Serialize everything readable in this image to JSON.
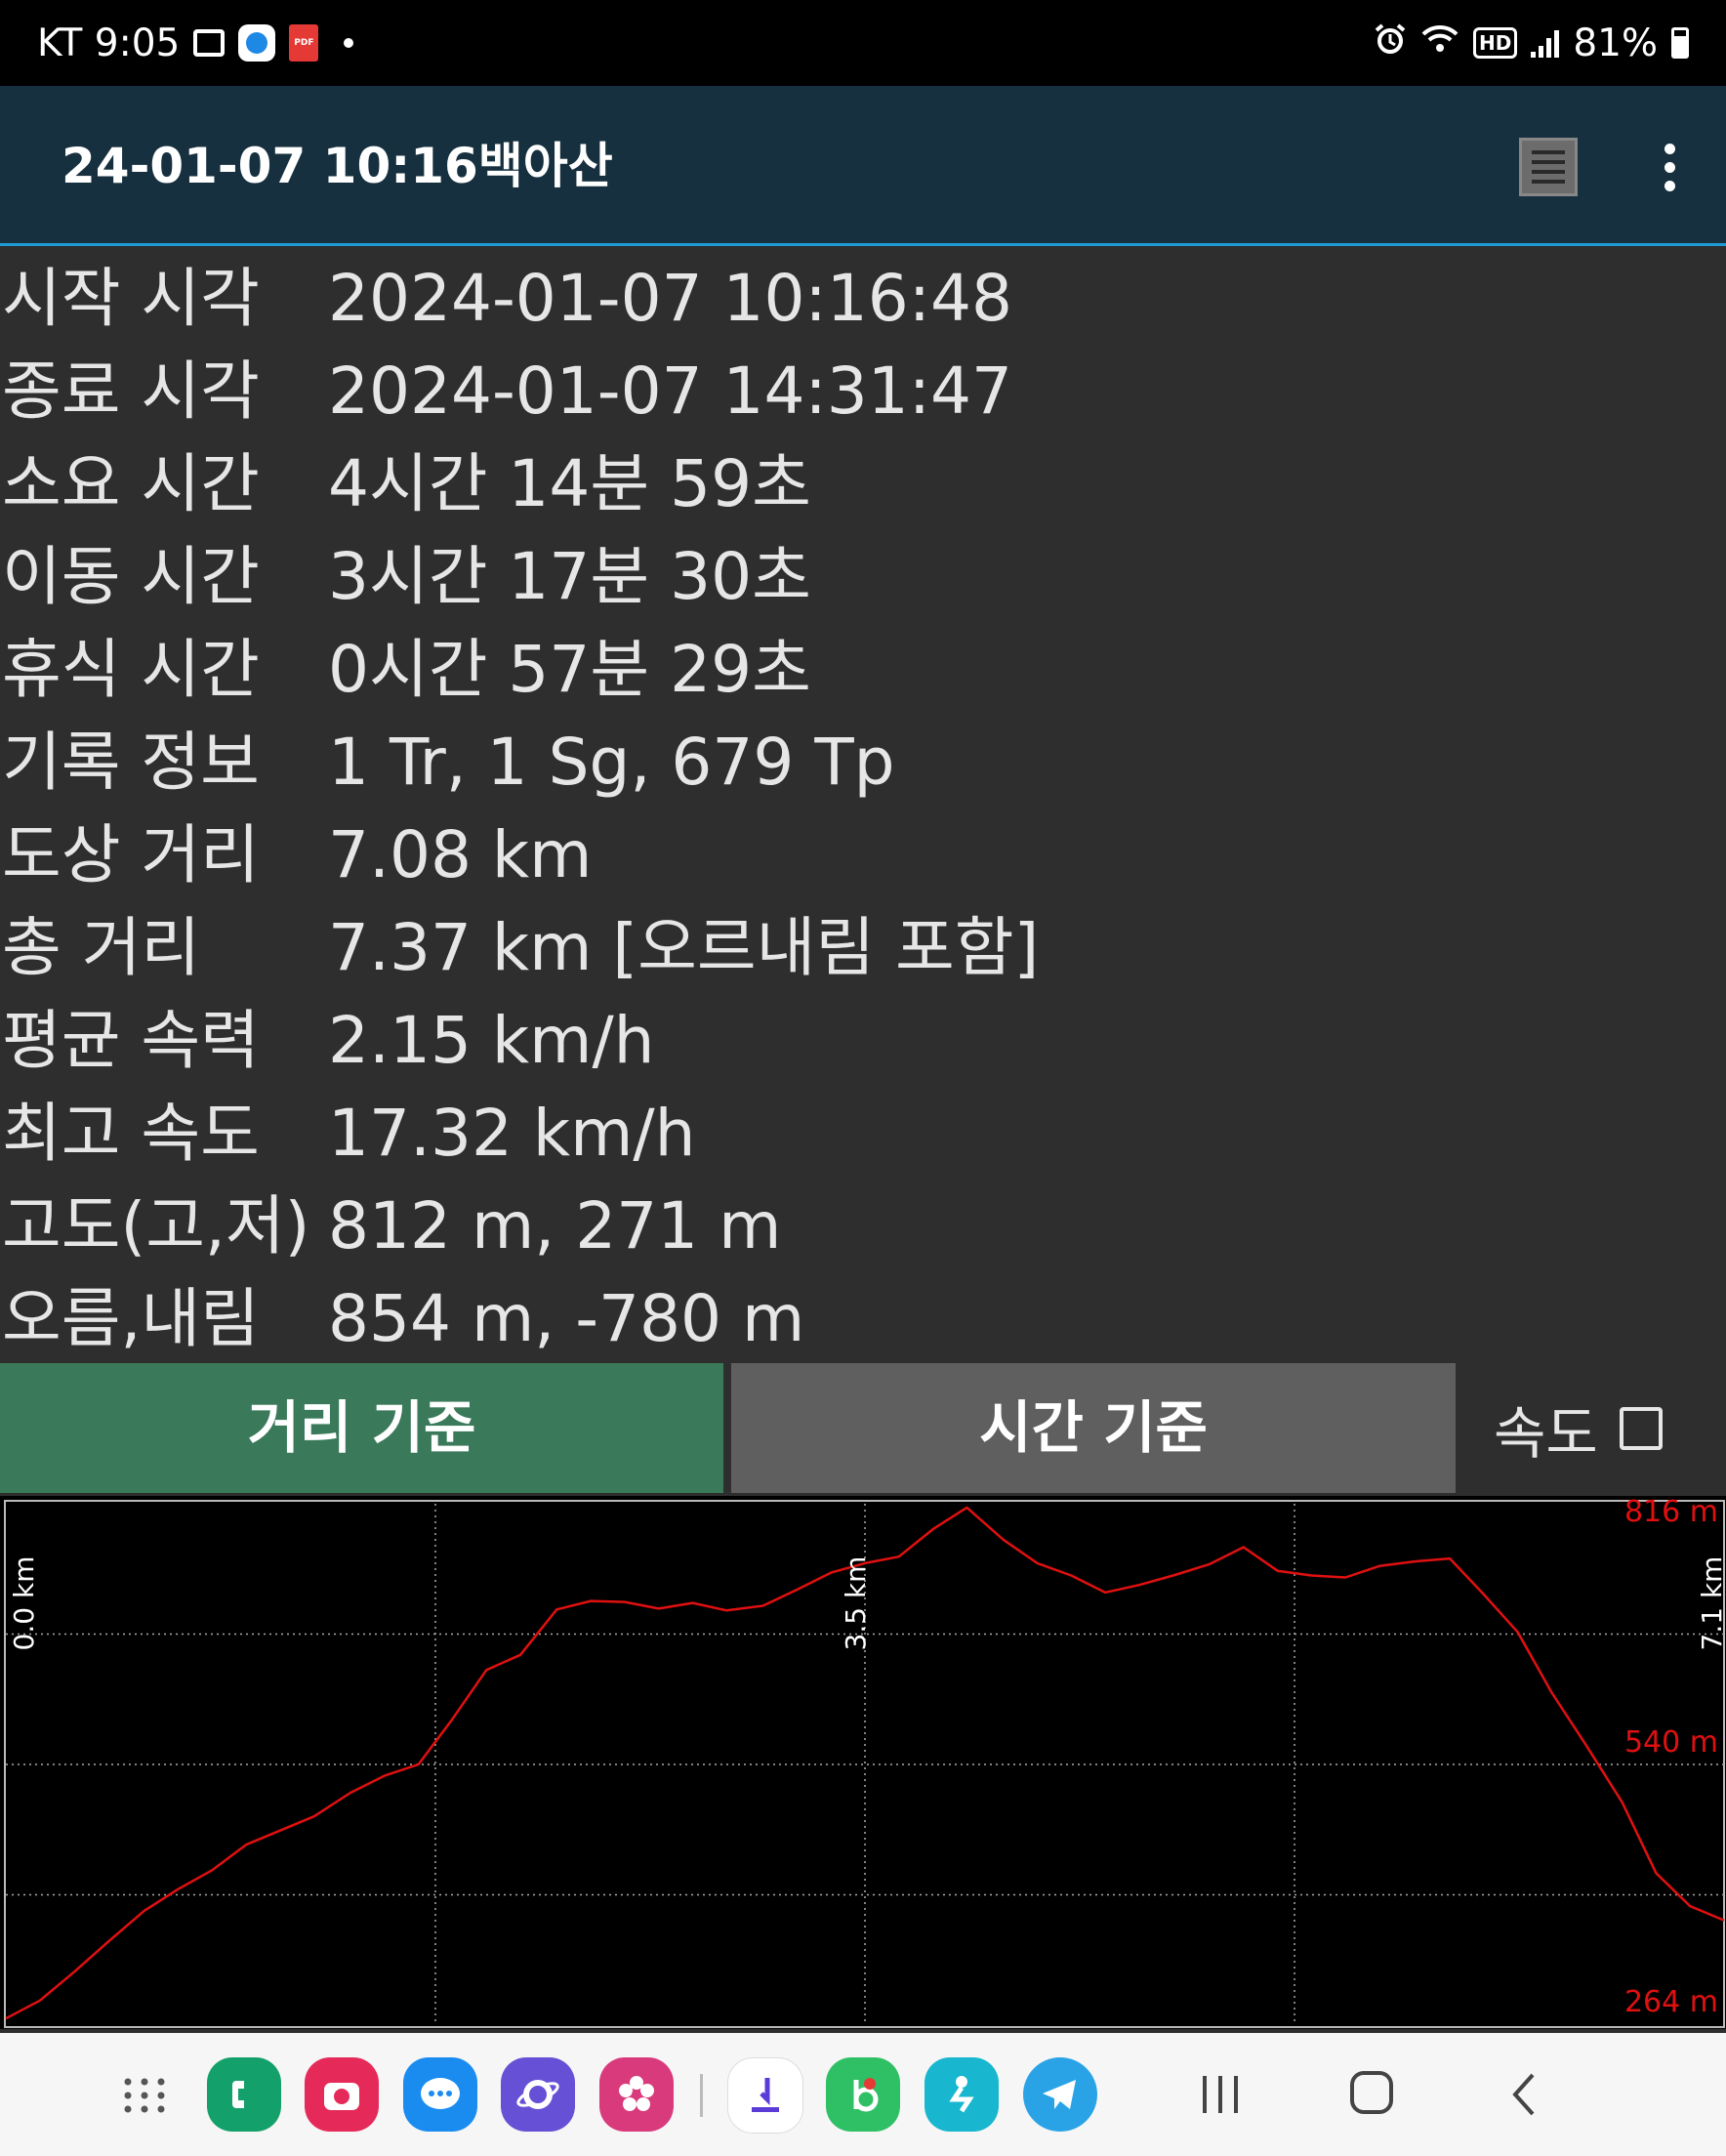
{
  "status_bar": {
    "carrier_time": "KT 9:05",
    "notification_icons": [
      "gallery-icon",
      "app-icon",
      "pdf-icon",
      "dot-icon"
    ],
    "status_icons": [
      "alarm-icon",
      "wifi-icon",
      "hd-icon",
      "signal-icon"
    ],
    "hd_label": "HD",
    "pdf_label": "PDF",
    "battery": "81%"
  },
  "appbar": {
    "title": "24-01-07 10:16백아산"
  },
  "info_rows": [
    {
      "label": "시작 시각",
      "value": "2024-01-07 10:16:48"
    },
    {
      "label": "종료 시각",
      "value": "2024-01-07 14:31:47"
    },
    {
      "label": "소요 시간",
      "value": "4시간 14분 59초"
    },
    {
      "label": "이동 시간",
      "value": "3시간 17분 30초"
    },
    {
      "label": "휴식 시간",
      "value": "0시간 57분 29초"
    },
    {
      "label": "기록 정보",
      "value": "1 Tr, 1 Sg, 679 Tp"
    },
    {
      "label": "도상 거리",
      "value": "7.08 km"
    },
    {
      "label": "총 거리",
      "value": "7.37 km [오르내림 포함]"
    },
    {
      "label": "평균 속력",
      "value": "2.15 km/h"
    },
    {
      "label": "최고 속도",
      "value": "17.32 km/h"
    },
    {
      "label": "고도(고,저)",
      "value": "812 m, 271 m"
    },
    {
      "label": "오름,내림",
      "value": "854 m, -780 m"
    }
  ],
  "tabs": {
    "distance": "거리 기준",
    "time": "시간 기준",
    "speed": "속도",
    "active": "distance",
    "speed_checked": false
  },
  "chart_data": {
    "type": "line",
    "x_unit": "km",
    "y_unit": "m",
    "x_tick_labels": [
      "0.0 km",
      "3.5 km",
      "7.1 km"
    ],
    "y_tick_labels": [
      "816 m",
      "540 m",
      "264 m"
    ],
    "xlim": [
      0,
      7.08
    ],
    "ylim": [
      264,
      816
    ],
    "grid": true,
    "line_color": "#e01010",
    "label_color": "#e01010",
    "series": [
      {
        "x": [
          0.0,
          0.14,
          0.28,
          0.42,
          0.57,
          0.71,
          0.85,
          0.99,
          1.13,
          1.27,
          1.42,
          1.56,
          1.7,
          1.84,
          1.98,
          2.12,
          2.27,
          2.41,
          2.55,
          2.69,
          2.83,
          2.97,
          3.12,
          3.26,
          3.4,
          3.54,
          3.68,
          3.82,
          3.96,
          4.11,
          4.25,
          4.39,
          4.53,
          4.67,
          4.81,
          4.96,
          5.1,
          5.24,
          5.38,
          5.52,
          5.66,
          5.81,
          5.95,
          6.09,
          6.23,
          6.37,
          6.51,
          6.66,
          6.8,
          6.94,
          7.08
        ],
        "y": [
          271,
          290,
          320,
          352,
          385,
          408,
          428,
          455,
          470,
          485,
          510,
          528,
          540,
          588,
          640,
          656,
          704,
          713,
          712,
          705,
          711,
          703,
          708,
          725,
          743,
          753,
          760,
          789,
          812,
          778,
          753,
          740,
          722,
          730,
          740,
          752,
          770,
          745,
          740,
          738,
          750,
          755,
          758,
          720,
          680,
          616,
          561,
          500,
          425,
          390,
          375
        ]
      }
    ]
  },
  "navbar": {
    "apps": [
      "app-drawer-icon",
      "phone-icon",
      "camera-icon",
      "messages-icon",
      "internet-icon",
      "blossom-icon",
      "download-icon",
      "b-app-icon",
      "tracker-icon",
      "telegram-icon"
    ],
    "buttons": [
      "recents-button",
      "home-button",
      "back-button"
    ]
  }
}
